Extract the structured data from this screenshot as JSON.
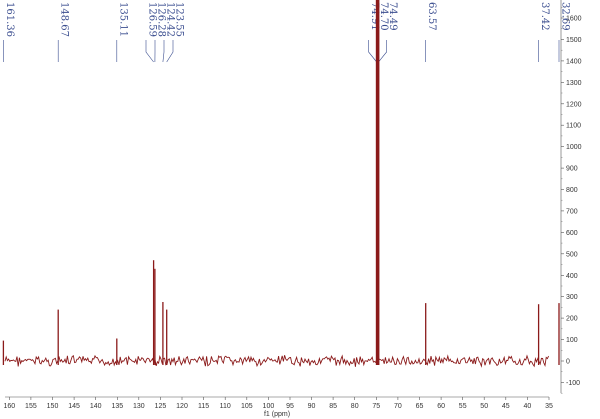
{
  "chart_data": {
    "type": "line",
    "title": "",
    "xlabel": "f1 (ppm)",
    "ylabel": "",
    "xlim": [
      161,
      35
    ],
    "ylim": [
      -170,
      1700
    ],
    "x_axis_reversed": true,
    "x_ticks": [
      160,
      155,
      150,
      145,
      140,
      135,
      130,
      125,
      120,
      115,
      110,
      105,
      100,
      95,
      90,
      85,
      80,
      75,
      70,
      65,
      60,
      55,
      50,
      45,
      40,
      35
    ],
    "x_tick_labels": [
      "160",
      "155",
      "150",
      "145",
      "140",
      "135",
      "130",
      "125",
      "120",
      "115",
      "110",
      "105",
      "100",
      "95",
      "90",
      "85",
      "80",
      "75",
      "70",
      "65",
      "60",
      "55",
      "50",
      "45",
      "40",
      "35"
    ],
    "y_ticks": [
      1600,
      1500,
      1400,
      1300,
      1200,
      1100,
      1000,
      900,
      800,
      700,
      600,
      500,
      400,
      300,
      200,
      100,
      0,
      -100
    ],
    "y_tick_labels": [
      "1600",
      "1500",
      "1400",
      "1300",
      "1200",
      "1100",
      "1000",
      "900",
      "800",
      "700",
      "600",
      "500",
      "400",
      "300",
      "200",
      "100",
      "0",
      "-100"
    ],
    "y_axis_side": "right",
    "grid": false,
    "series": [
      {
        "color": "#8b1a1a",
        "peaks": [
          {
            "x": 161.36,
            "y": 95
          },
          {
            "x": 148.67,
            "y": 240
          },
          {
            "x": 135.11,
            "y": 105
          },
          {
            "x": 126.59,
            "y": 470
          },
          {
            "x": 126.28,
            "y": 430
          },
          {
            "x": 124.42,
            "y": 275
          },
          {
            "x": 123.55,
            "y": 240
          },
          {
            "x": 74.91,
            "y": 1690
          },
          {
            "x": 74.7,
            "y": 1690
          },
          {
            "x": 74.49,
            "y": 1690
          },
          {
            "x": 63.57,
            "y": 270
          },
          {
            "x": 37.42,
            "y": 265
          },
          {
            "x": 32.69,
            "y": 270
          }
        ]
      }
    ],
    "peak_labels": [
      {
        "text": "161.36",
        "ppm": 161.36
      },
      {
        "text": "148.67",
        "ppm": 148.67
      },
      {
        "text": "135.11",
        "ppm": 135.11
      },
      {
        "text": "126.59",
        "ppm": 126.59
      },
      {
        "text": "126.28",
        "ppm": 126.28
      },
      {
        "text": "124.42",
        "ppm": 124.42
      },
      {
        "text": "123.55",
        "ppm": 123.55
      },
      {
        "text": "74.91",
        "ppm": 74.91
      },
      {
        "text": "74.70",
        "ppm": 74.7
      },
      {
        "text": "74.49",
        "ppm": 74.49
      },
      {
        "text": "63.57",
        "ppm": 63.57
      },
      {
        "text": "37.42",
        "ppm": 37.42
      },
      {
        "text": "32.69",
        "ppm": 32.69
      }
    ],
    "colors": {
      "spectrum": "#8b1a1a",
      "labels": "#3a4d8f",
      "axes": "#333333"
    }
  }
}
